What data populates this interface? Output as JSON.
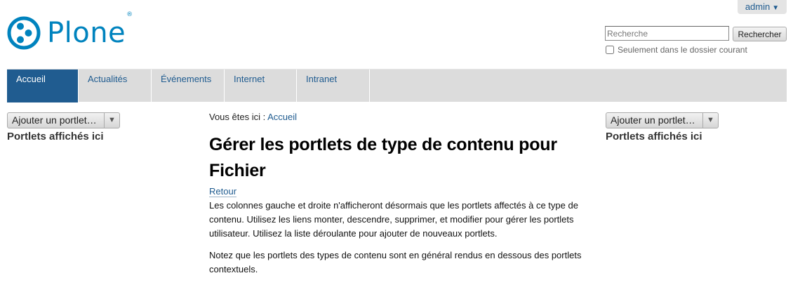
{
  "userbar": {
    "label": "admin",
    "arrow": "▼"
  },
  "logo": {
    "text": "Plone",
    "reg": "®",
    "color": "#0083be"
  },
  "search": {
    "placeholder": "Recherche",
    "button_label": "Rechercher",
    "option_label": "Seulement dans le dossier courant"
  },
  "nav": {
    "items": [
      {
        "label": "Accueil"
      },
      {
        "label": "Actualités"
      },
      {
        "label": "Événements"
      },
      {
        "label": "Internet"
      },
      {
        "label": "Intranet"
      }
    ]
  },
  "left_column": {
    "add_label": "Ajouter un portlet…",
    "dropdown_icon": "▼",
    "heading": "Portlets affichés ici"
  },
  "right_column": {
    "add_label": "Ajouter un portlet…",
    "dropdown_icon": "▼",
    "heading": "Portlets affichés ici"
  },
  "main": {
    "breadcrumb_prefix": "Vous êtes ici :",
    "breadcrumb_link": "Accueil",
    "title": "Gérer les portlets de type de contenu pour Fichier",
    "back_link": "Retour",
    "paragraph1": "Les colonnes gauche et droite n'afficheront désormais que les portlets affectés à ce type de contenu. Utilisez les liens monter, descendre, supprimer, et modifier pour gérer les portlets utilisateur. Utilisez la liste déroulante pour ajouter de nouveaux portlets.",
    "paragraph2": "Notez que les portlets des types de contenu sont en général rendus en dessous des portlets contextuels."
  }
}
